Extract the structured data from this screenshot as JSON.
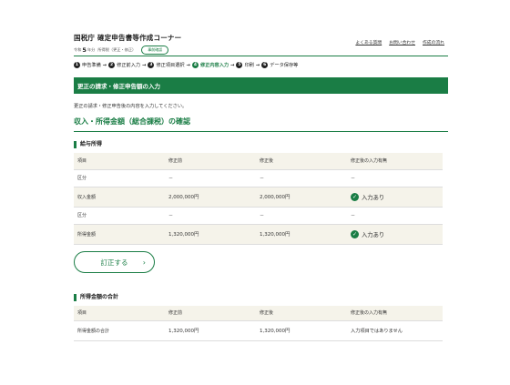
{
  "header": {
    "title": "国税庁 確定申告書等作成コーナー",
    "era": "令和",
    "year": "5",
    "year_suffix": "年分",
    "tax_type": "所得税（更正・修正）",
    "pill": "事前確認",
    "links": [
      "よくある質問",
      "お問い合わせ",
      "作成の流れ"
    ]
  },
  "steps": [
    {
      "num": "1",
      "label": "申告準備",
      "active": false
    },
    {
      "num": "2",
      "label": "修正前入力",
      "active": false
    },
    {
      "num": "3",
      "label": "修正項目選択",
      "active": false
    },
    {
      "num": "4",
      "label": "修正内容入力",
      "active": true
    },
    {
      "num": "5",
      "label": "印刷",
      "active": false
    },
    {
      "num": "6",
      "label": "データ保存等",
      "active": false
    }
  ],
  "banner": "更正の請求・修正申告額の入力",
  "intro": "更正の請求・修正申告後の内容を入力してください。",
  "section_title": "収入・所得金額（総合課税）の確認",
  "salary": {
    "title": "給与所得",
    "headers": [
      "項目",
      "修正前",
      "修正後",
      "修正後の入力有無"
    ],
    "rows": [
      {
        "item": "区分",
        "before": "－",
        "after": "－",
        "status": "－",
        "checked": false
      },
      {
        "item": "収入金額",
        "before": "2,000,000円",
        "after": "2,000,000円",
        "status": "入力あり",
        "checked": true
      },
      {
        "item": "区分",
        "before": "－",
        "after": "－",
        "status": "－",
        "checked": false
      },
      {
        "item": "所得金額",
        "before": "1,320,000円",
        "after": "1,320,000円",
        "status": "入力あり",
        "checked": true
      }
    ]
  },
  "edit_button": "訂正する",
  "total": {
    "title": "所得金額の合計",
    "headers": [
      "項目",
      "修正前",
      "修正後",
      "修正後の入力有無"
    ],
    "rows": [
      {
        "item": "所得金額の合計",
        "before": "1,320,000円",
        "after": "1,320,000円",
        "status": "入力項目ではありません",
        "checked": false
      }
    ]
  },
  "colors": {
    "accent": "#1a7d45",
    "row_shade": "#f5f3ea"
  },
  "icons": {
    "check": "check-circle-icon",
    "chevron": "chevron-right-icon"
  }
}
